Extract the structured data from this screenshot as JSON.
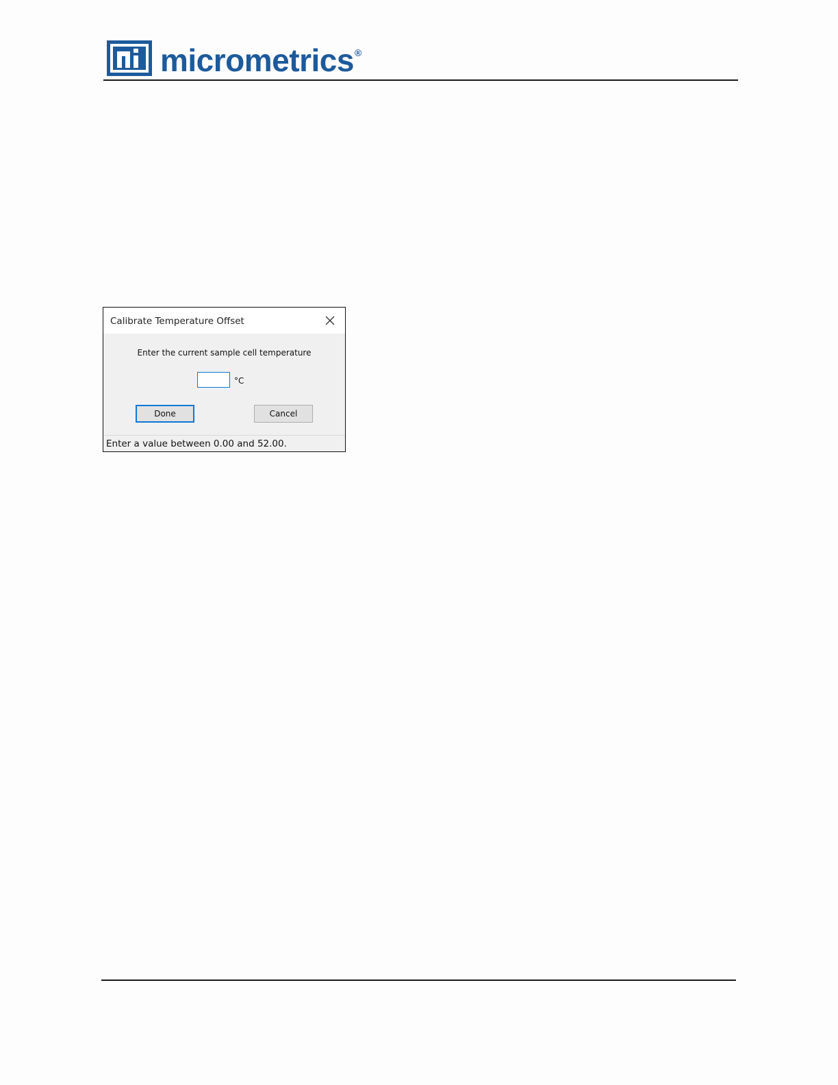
{
  "header": {
    "logo_text": "micrometrics",
    "logo_mark": "mi",
    "registered_symbol": "®",
    "brand_color": "#1d5a9c"
  },
  "dialog": {
    "title": "Calibrate Temperature Offset",
    "close_icon": "close-icon",
    "prompt": "Enter the current sample cell temperature",
    "temperature_input": {
      "value": "",
      "placeholder": ""
    },
    "unit": "°C",
    "done_label": "Done",
    "cancel_label": "Cancel",
    "status_text": "Enter a value between 0.00 and 52.00.",
    "accent_color": "#0a78d7"
  }
}
